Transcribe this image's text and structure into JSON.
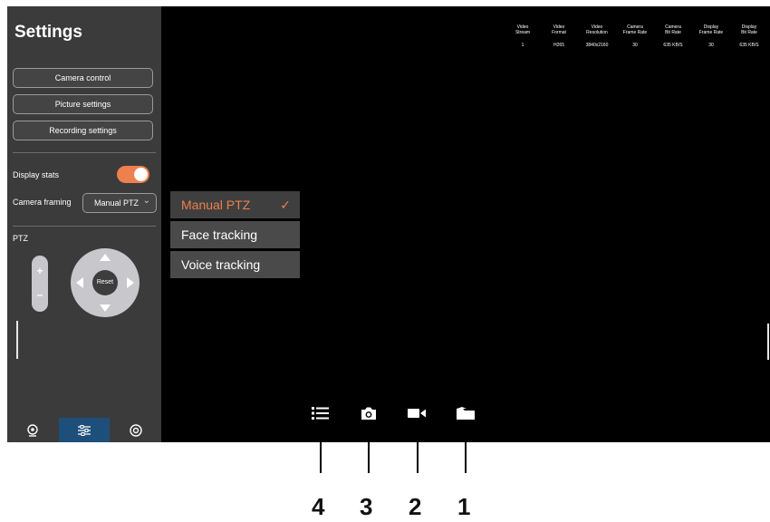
{
  "sidebar": {
    "title": "Settings",
    "buttons": [
      "Camera control",
      "Picture settings",
      "Recording settings"
    ],
    "display_stats_label": "Display stats",
    "display_stats_on": true,
    "camera_framing_label": "Camera framing",
    "camera_framing_value": "Manual PTZ",
    "ptz_label": "PTZ",
    "zoom_plus": "+",
    "zoom_minus": "–",
    "reset_label": "Reset",
    "tabs": [
      {
        "name": "camera-tab",
        "icon": "webcam-icon",
        "active": false
      },
      {
        "name": "sliders-tab",
        "icon": "sliders-icon",
        "active": true
      },
      {
        "name": "settings-tab",
        "icon": "gear-icon",
        "active": false
      }
    ]
  },
  "framing_dropdown": {
    "options": [
      "Manual PTZ",
      "Face tracking",
      "Voice tracking"
    ],
    "selected": "Manual PTZ"
  },
  "stats": {
    "headers": [
      [
        "Video",
        "Stream"
      ],
      [
        "Video",
        "Format"
      ],
      [
        "Video",
        "Resolution"
      ],
      [
        "Camera",
        "Frame Rate"
      ],
      [
        "Camera",
        "Bit Rate"
      ],
      [
        "Display",
        "Frame Rate"
      ],
      [
        "Display",
        "Bit Rate"
      ]
    ],
    "values": [
      "1",
      "H265",
      "3840x2160",
      "30",
      "635 KB/S",
      "30",
      "635 KB/S"
    ]
  },
  "toolbar": {
    "icons": [
      "list-icon",
      "camera-icon",
      "video-camera-icon",
      "folder-icon"
    ],
    "callouts": [
      "4",
      "3",
      "2",
      "1"
    ]
  },
  "colors": {
    "accent": "#ee7f4f",
    "active_tab": "#1d4f7a",
    "sidebar_bg": "#3b3b3b",
    "preview_bg": "#000000"
  }
}
